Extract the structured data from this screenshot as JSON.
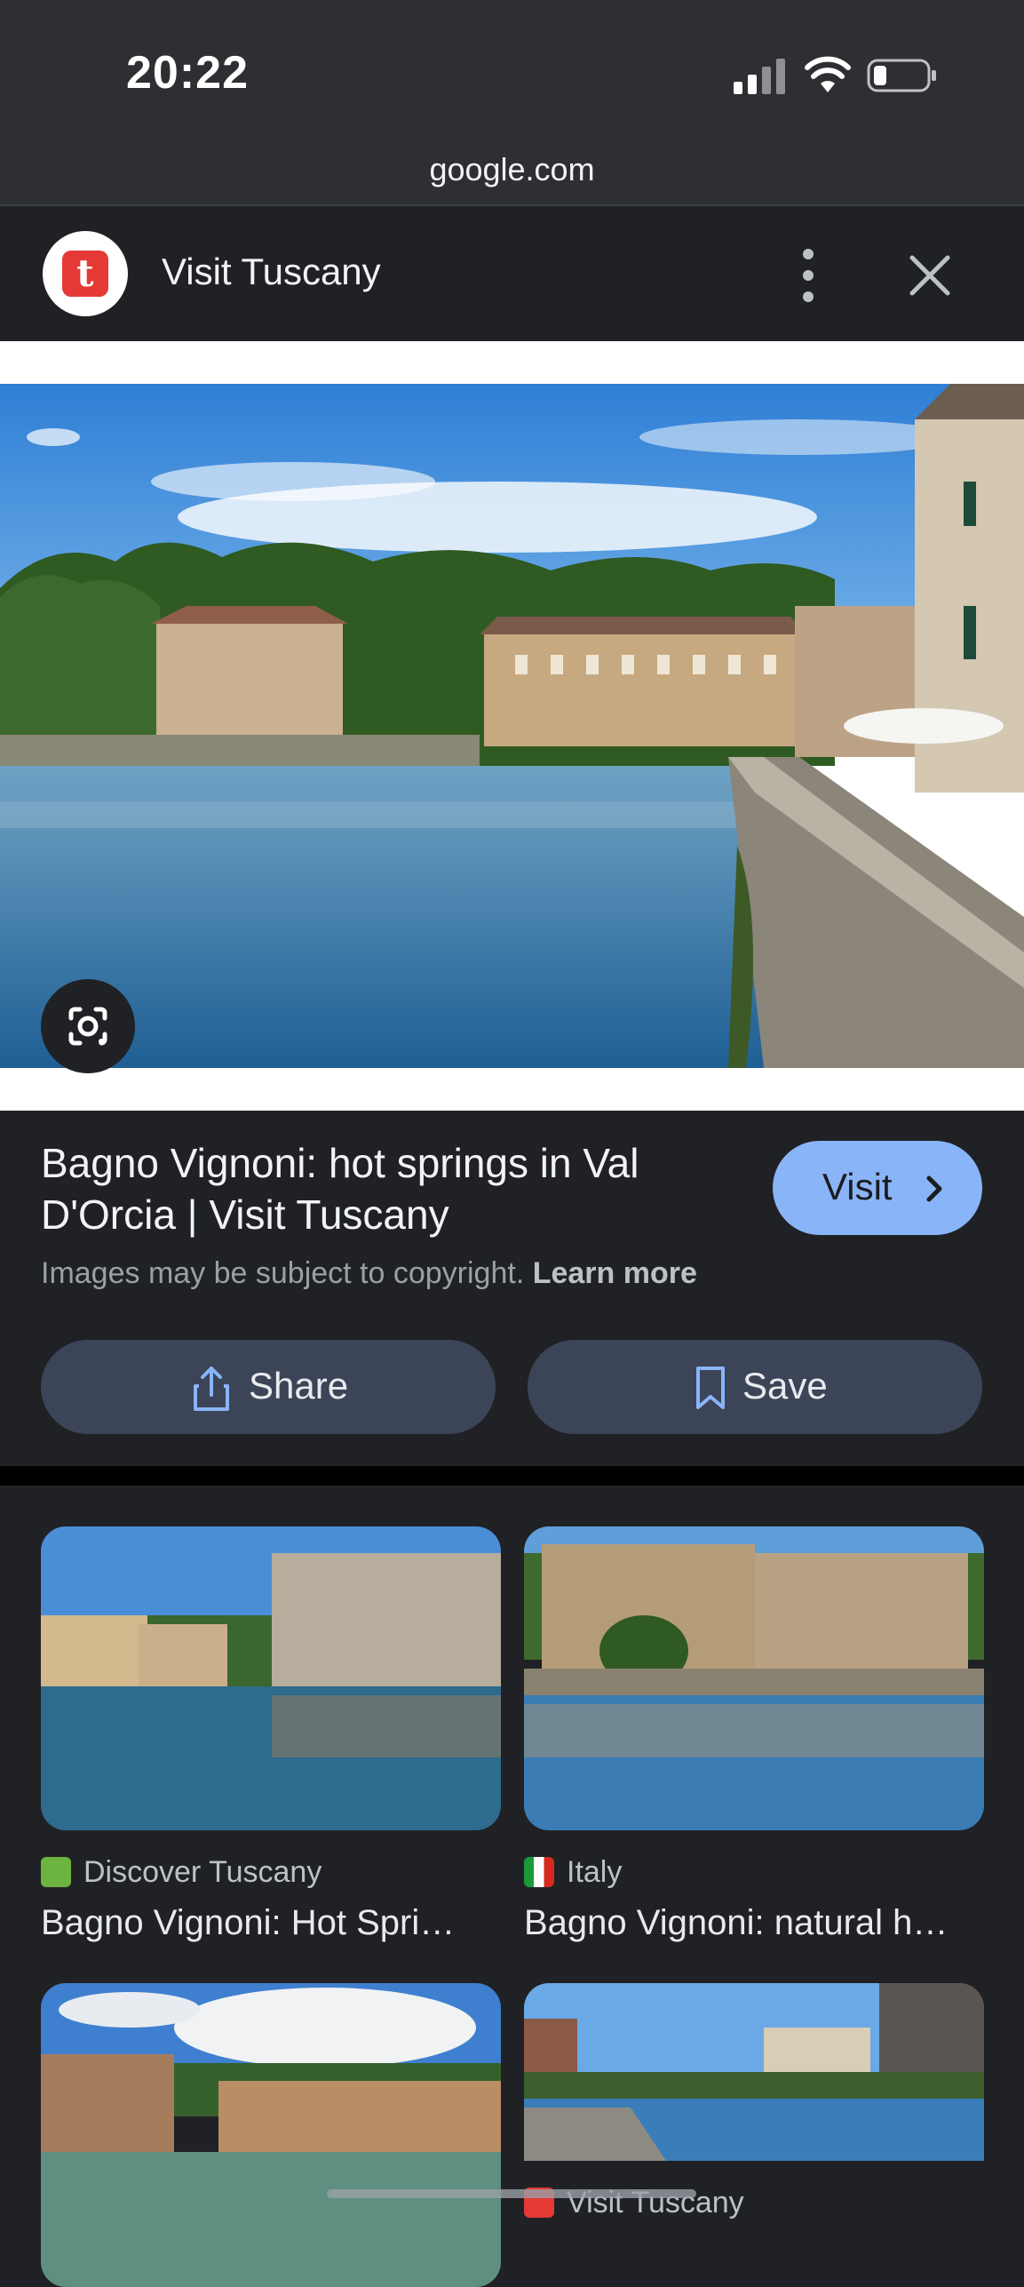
{
  "status_bar": {
    "time": "20:22",
    "url": "google.com"
  },
  "source_header": {
    "name": "Visit Tuscany",
    "logo_letter": "t"
  },
  "result": {
    "title": "Bagno Vignoni: hot springs in Val D'Orcia | Visit Tuscany",
    "visit_label": "Visit",
    "copyright_text": "Images may be subject to copyright.",
    "learn_more_label": "Learn more",
    "share_label": "Share",
    "save_label": "Save"
  },
  "related": [
    {
      "source": "Discover Tuscany",
      "title": "Bagno Vignoni: Hot Spri…"
    },
    {
      "source": "Italy",
      "title": "Bagno Vignoni: natural h…"
    },
    {
      "source": "",
      "title": ""
    },
    {
      "source": "Visit Tuscany",
      "title": ""
    }
  ],
  "colors": {
    "accent_button": "#8ab4f8",
    "secondary_button": "#3c4458",
    "background": "#202124",
    "logo_red": "#e53935"
  },
  "icons": [
    "signal-icon",
    "wifi-icon",
    "battery-icon",
    "more-vert-icon",
    "close-icon",
    "google-lens-icon",
    "chevron-right-icon",
    "share-icon",
    "bookmark-icon"
  ]
}
